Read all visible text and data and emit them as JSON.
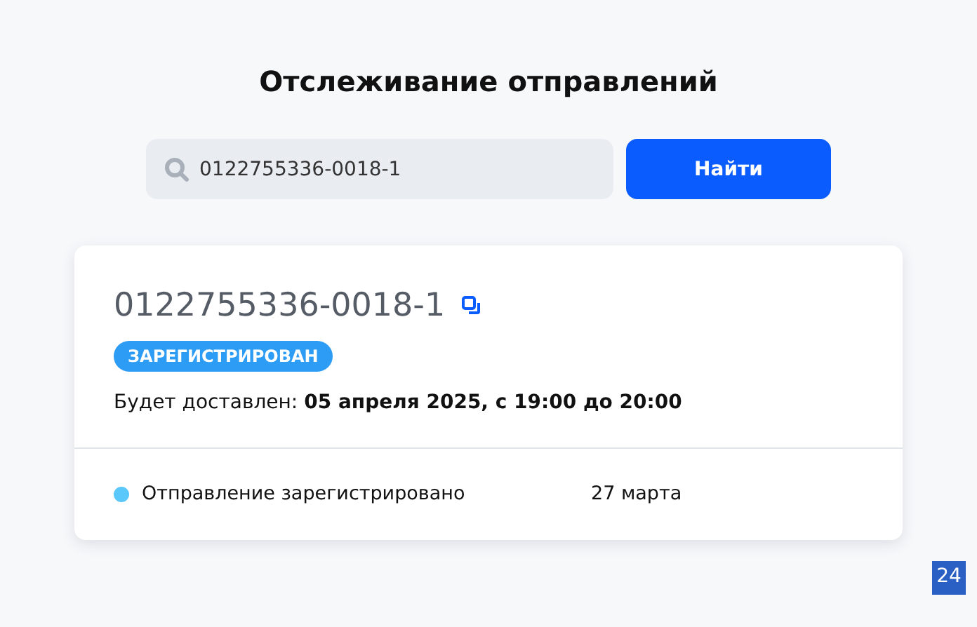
{
  "title": "Отслеживание отправлений",
  "search": {
    "value": "0122755336-0018-1",
    "button": "Найти"
  },
  "shipment": {
    "number": "0122755336-0018-1",
    "status": "ЗАРЕГИСТРИРОВАН",
    "delivery": "Будет доставлен: **05 апреля 2025, с 19:00 до 20:00**",
    "events": [
      {
        "text": "Отправление зарегистрировано",
        "date": "27 марта",
        "color": "#5ac8fa"
      }
    ]
  },
  "corner_badge": "24"
}
